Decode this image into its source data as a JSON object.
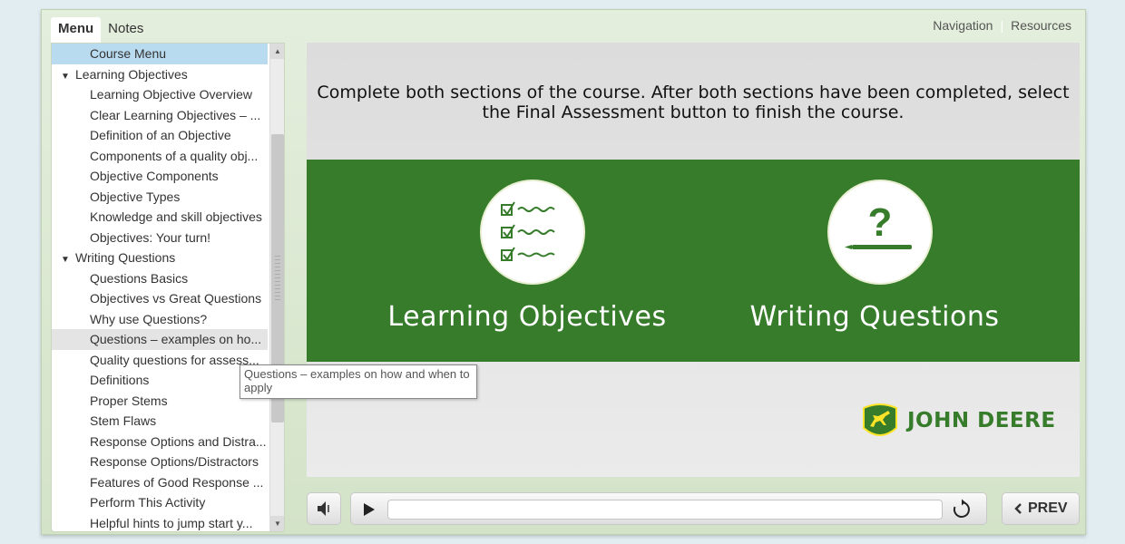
{
  "tabs": [
    "Menu",
    "Notes"
  ],
  "top_links": [
    "Navigation",
    "Resources"
  ],
  "menu": {
    "items": [
      {
        "label": "Course Menu",
        "level": 2,
        "state": "current"
      },
      {
        "label": "Learning Objectives",
        "level": 1,
        "expanded": true
      },
      {
        "label": "Learning Objective Overview",
        "level": 2
      },
      {
        "label": "Clear Learning Objectives – ...",
        "level": 2
      },
      {
        "label": "Definition of an Objective",
        "level": 2
      },
      {
        "label": "Components of a quality obj...",
        "level": 2
      },
      {
        "label": "Objective Components",
        "level": 2
      },
      {
        "label": "Objective Types",
        "level": 2
      },
      {
        "label": "Knowledge and skill objectives",
        "level": 2
      },
      {
        "label": "Objectives: Your turn!",
        "level": 2
      },
      {
        "label": "Writing Questions",
        "level": 1,
        "expanded": true
      },
      {
        "label": "Questions Basics",
        "level": 2
      },
      {
        "label": "Objectives vs Great Questions",
        "level": 2
      },
      {
        "label": "Why use Questions?",
        "level": 2
      },
      {
        "label": "Questions – examples on ho...",
        "level": 2,
        "state": "hovered"
      },
      {
        "label": "Quality questions for assess...",
        "level": 2
      },
      {
        "label": "Definitions",
        "level": 2
      },
      {
        "label": "Proper Stems",
        "level": 2
      },
      {
        "label": "Stem Flaws",
        "level": 2
      },
      {
        "label": "Response Options and Distra...",
        "level": 2
      },
      {
        "label": "Response Options/Distractors",
        "level": 2
      },
      {
        "label": "Features of Good Response ...",
        "level": 2
      },
      {
        "label": "Perform This Activity",
        "level": 2
      },
      {
        "label": "Helpful hints to jump start y...",
        "level": 2
      }
    ],
    "tooltip": "Questions – examples on how and when to apply"
  },
  "slide": {
    "instructions": "Complete both sections of the course. After both sections have been completed, select the Final Assessment button to finish the course.",
    "sections": [
      {
        "title": "Learning Objectives",
        "icon": "checklist-icon"
      },
      {
        "title": "Writing Questions",
        "icon": "question-mark-icon"
      }
    ],
    "logo_text": "JOHN DEERE",
    "accent_color": "#367c2b"
  },
  "controls": {
    "prev_label": "PREV",
    "progress": 0
  }
}
